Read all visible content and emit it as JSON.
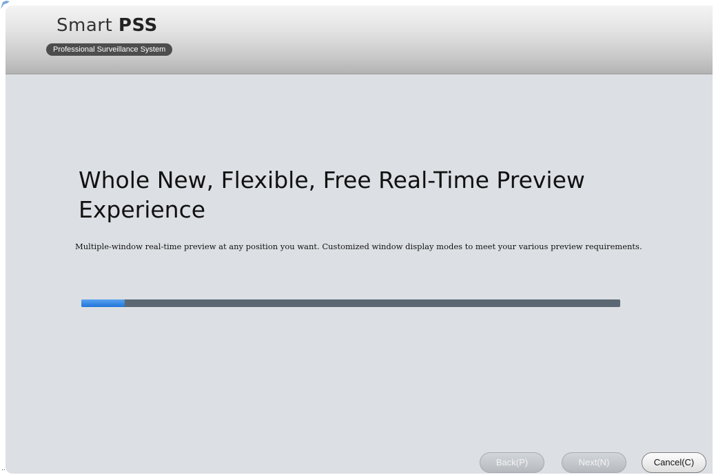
{
  "logo": {
    "title_light": "Smart ",
    "title_bold": "PSS",
    "tagline": "Professional Surveillance System"
  },
  "main": {
    "headline": "Whole New, Flexible, Free Real-Time Preview Experience",
    "description": "Multiple-window real-time preview at any position you want. Customized window display modes to meet your various preview requirements.",
    "progress_percent": 8
  },
  "buttons": {
    "back": "Back(P)",
    "next": "Next(N)",
    "cancel": "Cancel(C)"
  },
  "colors": {
    "progress_fill": "#1f74d9",
    "progress_track": "#5c6774",
    "background": "#dcdfe3"
  }
}
